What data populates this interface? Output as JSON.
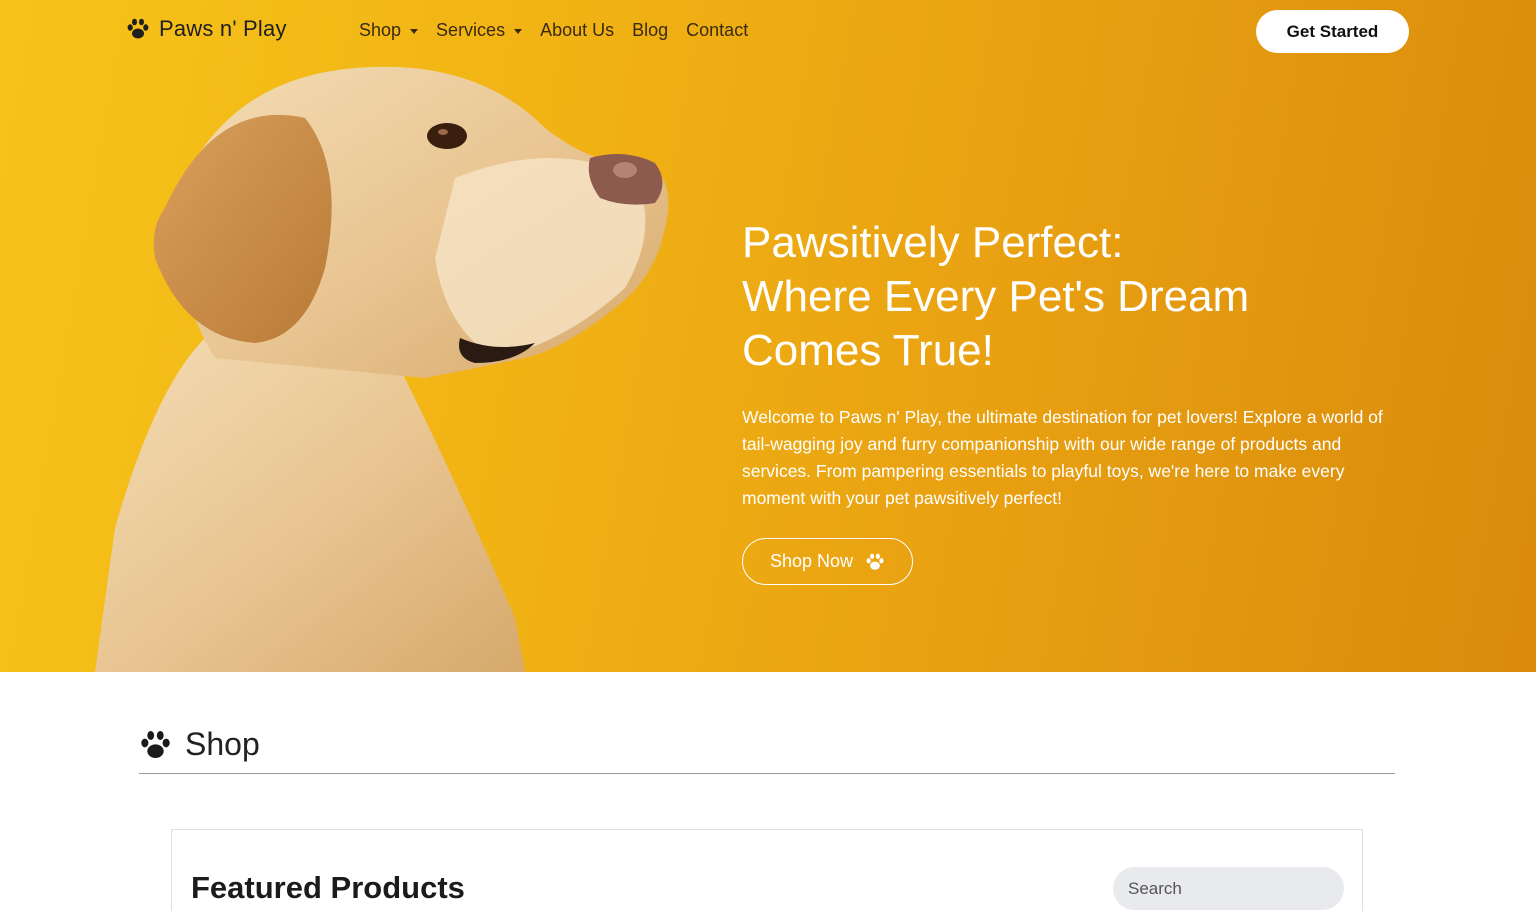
{
  "brand": {
    "name": "Paws n' Play",
    "icon": "paw-icon"
  },
  "nav": {
    "items": [
      {
        "label": "Shop",
        "dropdown": true
      },
      {
        "label": "Services",
        "dropdown": true
      },
      {
        "label": "About Us",
        "dropdown": false
      },
      {
        "label": "Blog",
        "dropdown": false
      },
      {
        "label": "Contact",
        "dropdown": false
      }
    ],
    "cta_label": "Get Started"
  },
  "hero": {
    "title_lines": [
      "Pawsitively Perfect:",
      "Where Every Pet's Dream",
      "Comes True!"
    ],
    "description": "Welcome to Paws n' Play, the ultimate destination for pet lovers! Explore a world of tail-wagging joy and furry companionship with our wide range of products and services. From pampering essentials to playful toys, we're here to make every moment with your pet pawsitively perfect!",
    "button_label": "Shop Now",
    "button_icon": "paw-icon"
  },
  "shop": {
    "heading": "Shop",
    "icon": "paw-icon",
    "featured_title": "Featured Products",
    "search_placeholder": "Search"
  },
  "colors": {
    "hero_bg_start": "#f7c31a",
    "hero_bg_end": "#d98a0c",
    "text_on_hero": "#ffffff"
  }
}
